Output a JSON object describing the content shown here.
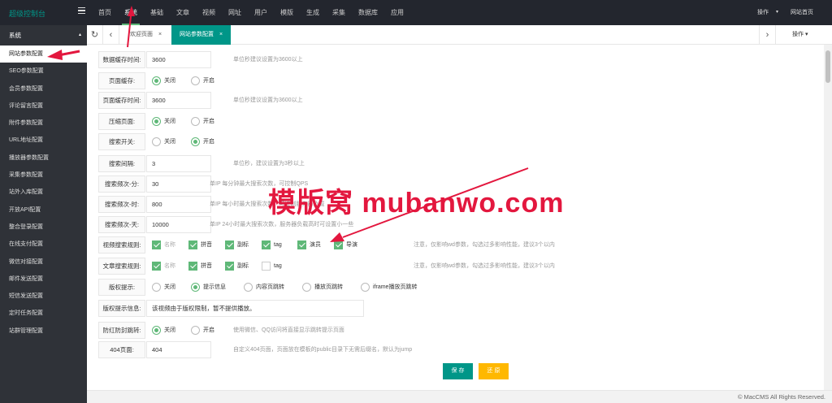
{
  "app": {
    "title": "超级控制台"
  },
  "nav": [
    "首页",
    "系统",
    "基础",
    "文章",
    "视频",
    "网址",
    "用户",
    "模版",
    "生成",
    "采集",
    "数据库",
    "应用"
  ],
  "header_right": {
    "ops": "操作",
    "caret": "▾",
    "site_home": "网站首页"
  },
  "sidebar": {
    "title": "系统",
    "caret": "▴",
    "items": [
      "网站参数配置",
      "SEO参数配置",
      "会员参数配置",
      "评论留言配置",
      "附件参数配置",
      "URL地址配置",
      "播放器参数配置",
      "采集参数配置",
      "站外入库配置",
      "开放API配置",
      "整合登录配置",
      "在线支付配置",
      "微信对接配置",
      "邮件发送配置",
      "短信发送配置",
      "定时任务配置",
      "站群管理配置"
    ]
  },
  "tabs": {
    "refresh": "↻",
    "prev": "‹",
    "next": "›",
    "home": "欢迎页面",
    "active": "网站参数配置",
    "close": "×",
    "ops": "操作 ▾"
  },
  "form": {
    "data_cache": {
      "label": "数据缓存时间:",
      "value": "3600",
      "tip": "单位秒建议设置为3600以上"
    },
    "page_cache": {
      "label": "页面缓存:",
      "opt1": "关闭",
      "opt2": "开启",
      "selected": "关闭"
    },
    "page_cache_time": {
      "label": "页面缓存时间:",
      "value": "3600",
      "tip": "单位秒建议设置为3600以上"
    },
    "compress": {
      "label": "压缩页面:",
      "opt1": "关闭",
      "opt2": "开启",
      "selected": "关闭"
    },
    "search_switch": {
      "label": "搜索开关:",
      "opt1": "关闭",
      "opt2": "开启",
      "selected": "开启"
    },
    "search_interval": {
      "label": "搜索间隔:",
      "value": "3",
      "tip": "单位秒，建议设置为3秒以上"
    },
    "search_min": {
      "label": "搜索频次-分:",
      "value": "30",
      "tip": "单IP 每分钟最大搜索次数，可控制QPS"
    },
    "search_hour": {
      "label": "搜索频次-时:",
      "value": "800",
      "tip": "单IP 每小时最大搜索次数，可控制服务器负载"
    },
    "search_day": {
      "label": "搜索频次-天:",
      "value": "10000",
      "tip": "单IP 24小时最大搜索次数，服务器负载高时可设置小一些"
    },
    "vod_rule": {
      "label": "视频搜索规则:",
      "opts": [
        "名称",
        "拼音",
        "副标",
        "tag",
        "演员",
        "导演"
      ],
      "tip": "注意，仅影响wd参数，勾选过多影响性能，建议3个以内"
    },
    "art_rule": {
      "label": "文章搜索规则:",
      "opts": [
        "名称",
        "拼音",
        "副标",
        "tag"
      ],
      "tip": "注意，仅影响wd参数，勾选过多影响性能，建议3个以内"
    },
    "copyright": {
      "label": "版权提示:",
      "opts": [
        "关闭",
        "提示信息",
        "内容页跳转",
        "播放页跳转",
        "iframe播放页跳转"
      ],
      "selected": "提示信息"
    },
    "copyright_msg": {
      "label": "版权提示信息:",
      "value": "该视频由于版权限制，暂不提供播放。"
    },
    "anti_block": {
      "label": "防红防封跳转:",
      "opt1": "关闭",
      "opt2": "开启",
      "selected": "关闭",
      "tip": "使用微信、QQ访问将直接显示跳转提示页面"
    },
    "page404": {
      "label": "404页面:",
      "value": "404",
      "tip": "自定义404页面，页面放在模板的public目录下无需后缀名，默认为jump"
    },
    "save": "保 存",
    "reset": "还 原"
  },
  "footer": {
    "copyright": "© MacCMS All Rights Reserved."
  },
  "watermark": "模版窝 mubanwo.com",
  "colors": {
    "accent": "#009688",
    "green": "#5FB878",
    "reset": "#FFB800",
    "watermark": "#e3173e",
    "topbar": "#23262e",
    "sidebar": "#2f3238"
  }
}
